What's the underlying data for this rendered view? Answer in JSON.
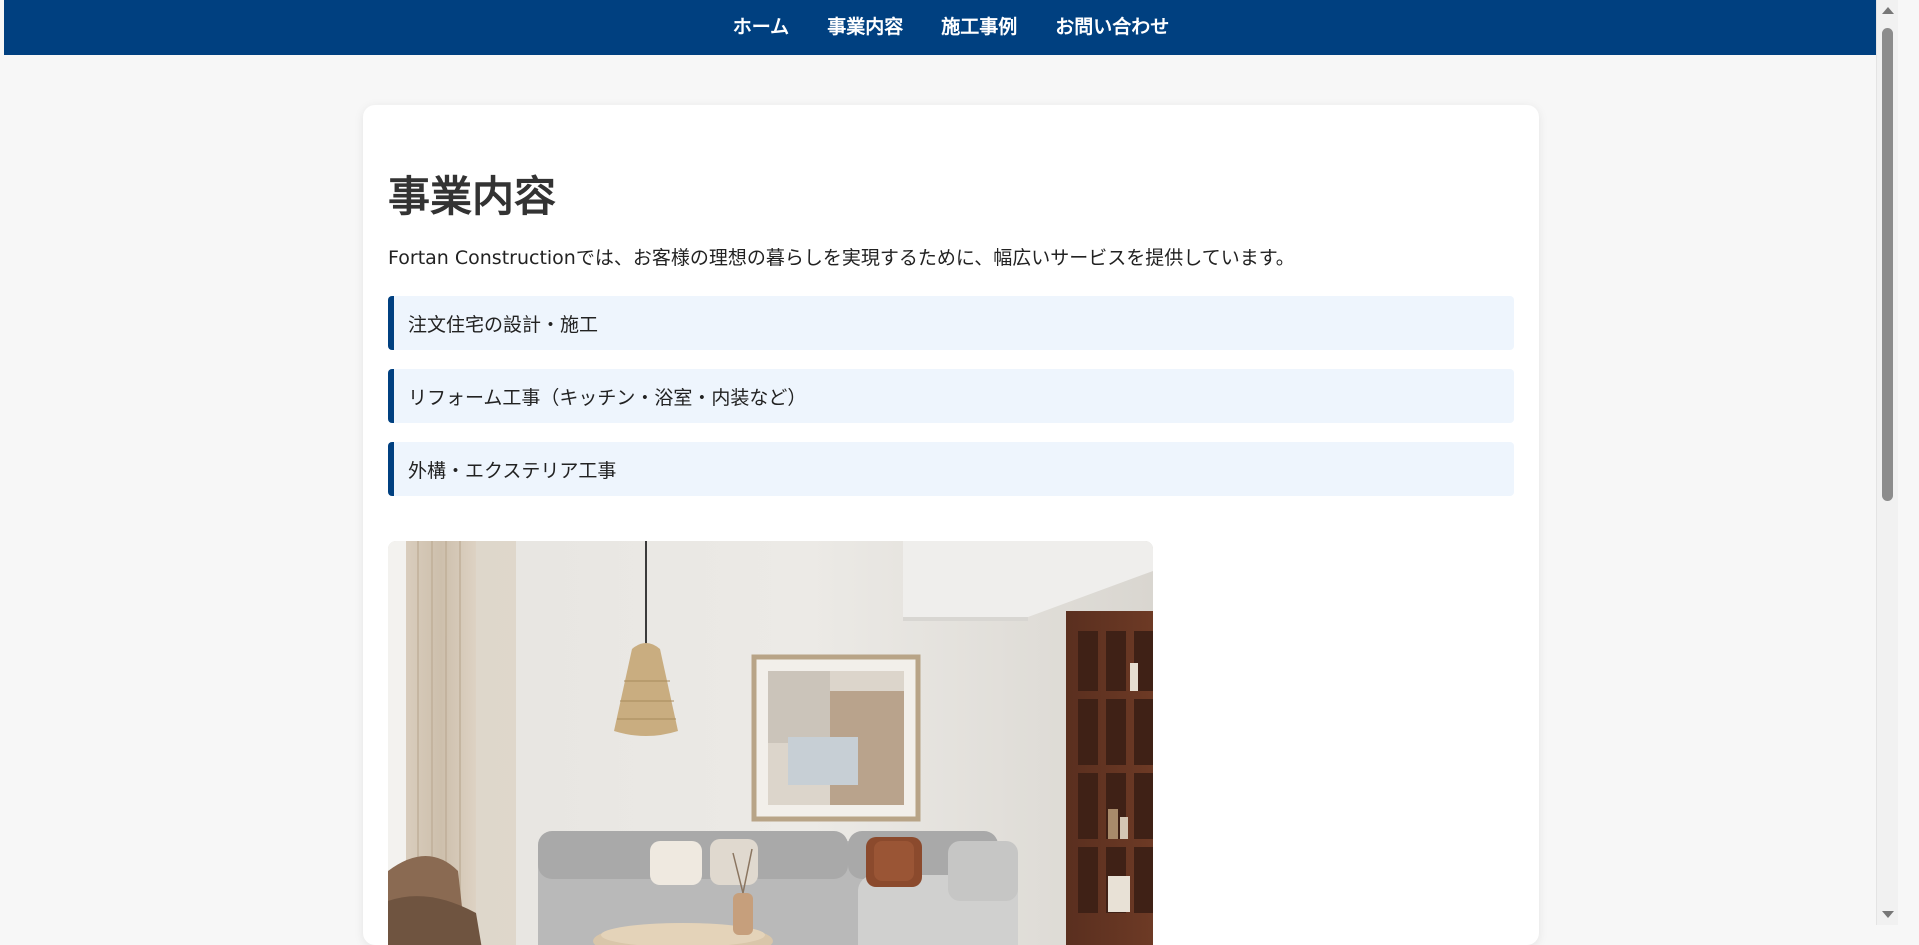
{
  "nav": {
    "items": [
      {
        "label": "ホーム"
      },
      {
        "label": "事業内容"
      },
      {
        "label": "施工事例"
      },
      {
        "label": "お問い合わせ"
      }
    ]
  },
  "main": {
    "title": "事業内容",
    "intro": "Fortan Constructionでは、お客様の理想の暮らしを実現するために、幅広いサービスを提供しています。",
    "services": [
      {
        "label": "注文住宅の設計・施工"
      },
      {
        "label": "リフォーム工事（キッチン・浴室・内装など）"
      },
      {
        "label": "外構・エクステリア工事"
      }
    ]
  },
  "colors": {
    "nav_bg": "#004080",
    "accent": "#004080",
    "service_bg": "#eef5fd",
    "page_bg": "#f7f7f7"
  }
}
